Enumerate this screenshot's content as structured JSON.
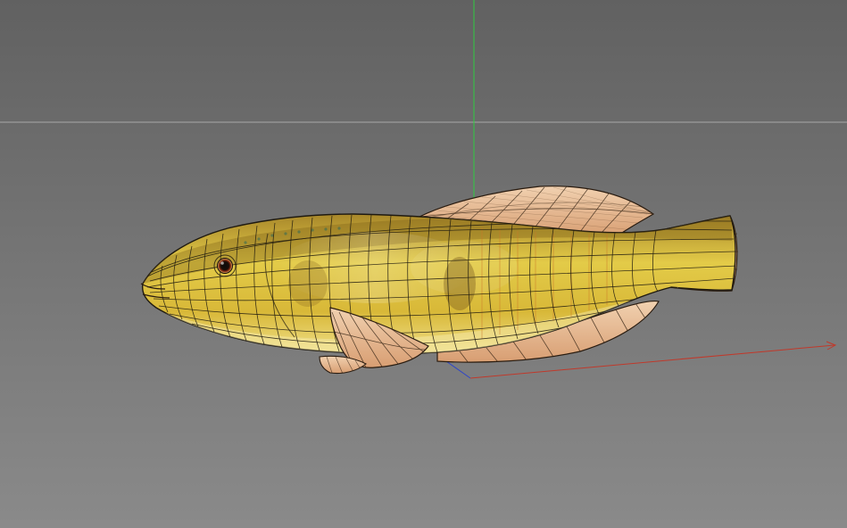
{
  "viewport": {
    "background_top": "#616161",
    "background_bottom": "#8a8a8a",
    "horizon_line_color": "#a8a8a8",
    "axis_colors": {
      "x": "#c0392b",
      "y": "#2ecc40",
      "z": "#2e45c8"
    }
  },
  "model": {
    "object": "fish",
    "display_mode": "textured-wireframe",
    "body_color_light": "#e6cf4a",
    "body_color_dark": "#b89421",
    "fin_color": "#e4b48c",
    "wire_color": "#1f1a10",
    "eye_color": "#8a2a14"
  }
}
